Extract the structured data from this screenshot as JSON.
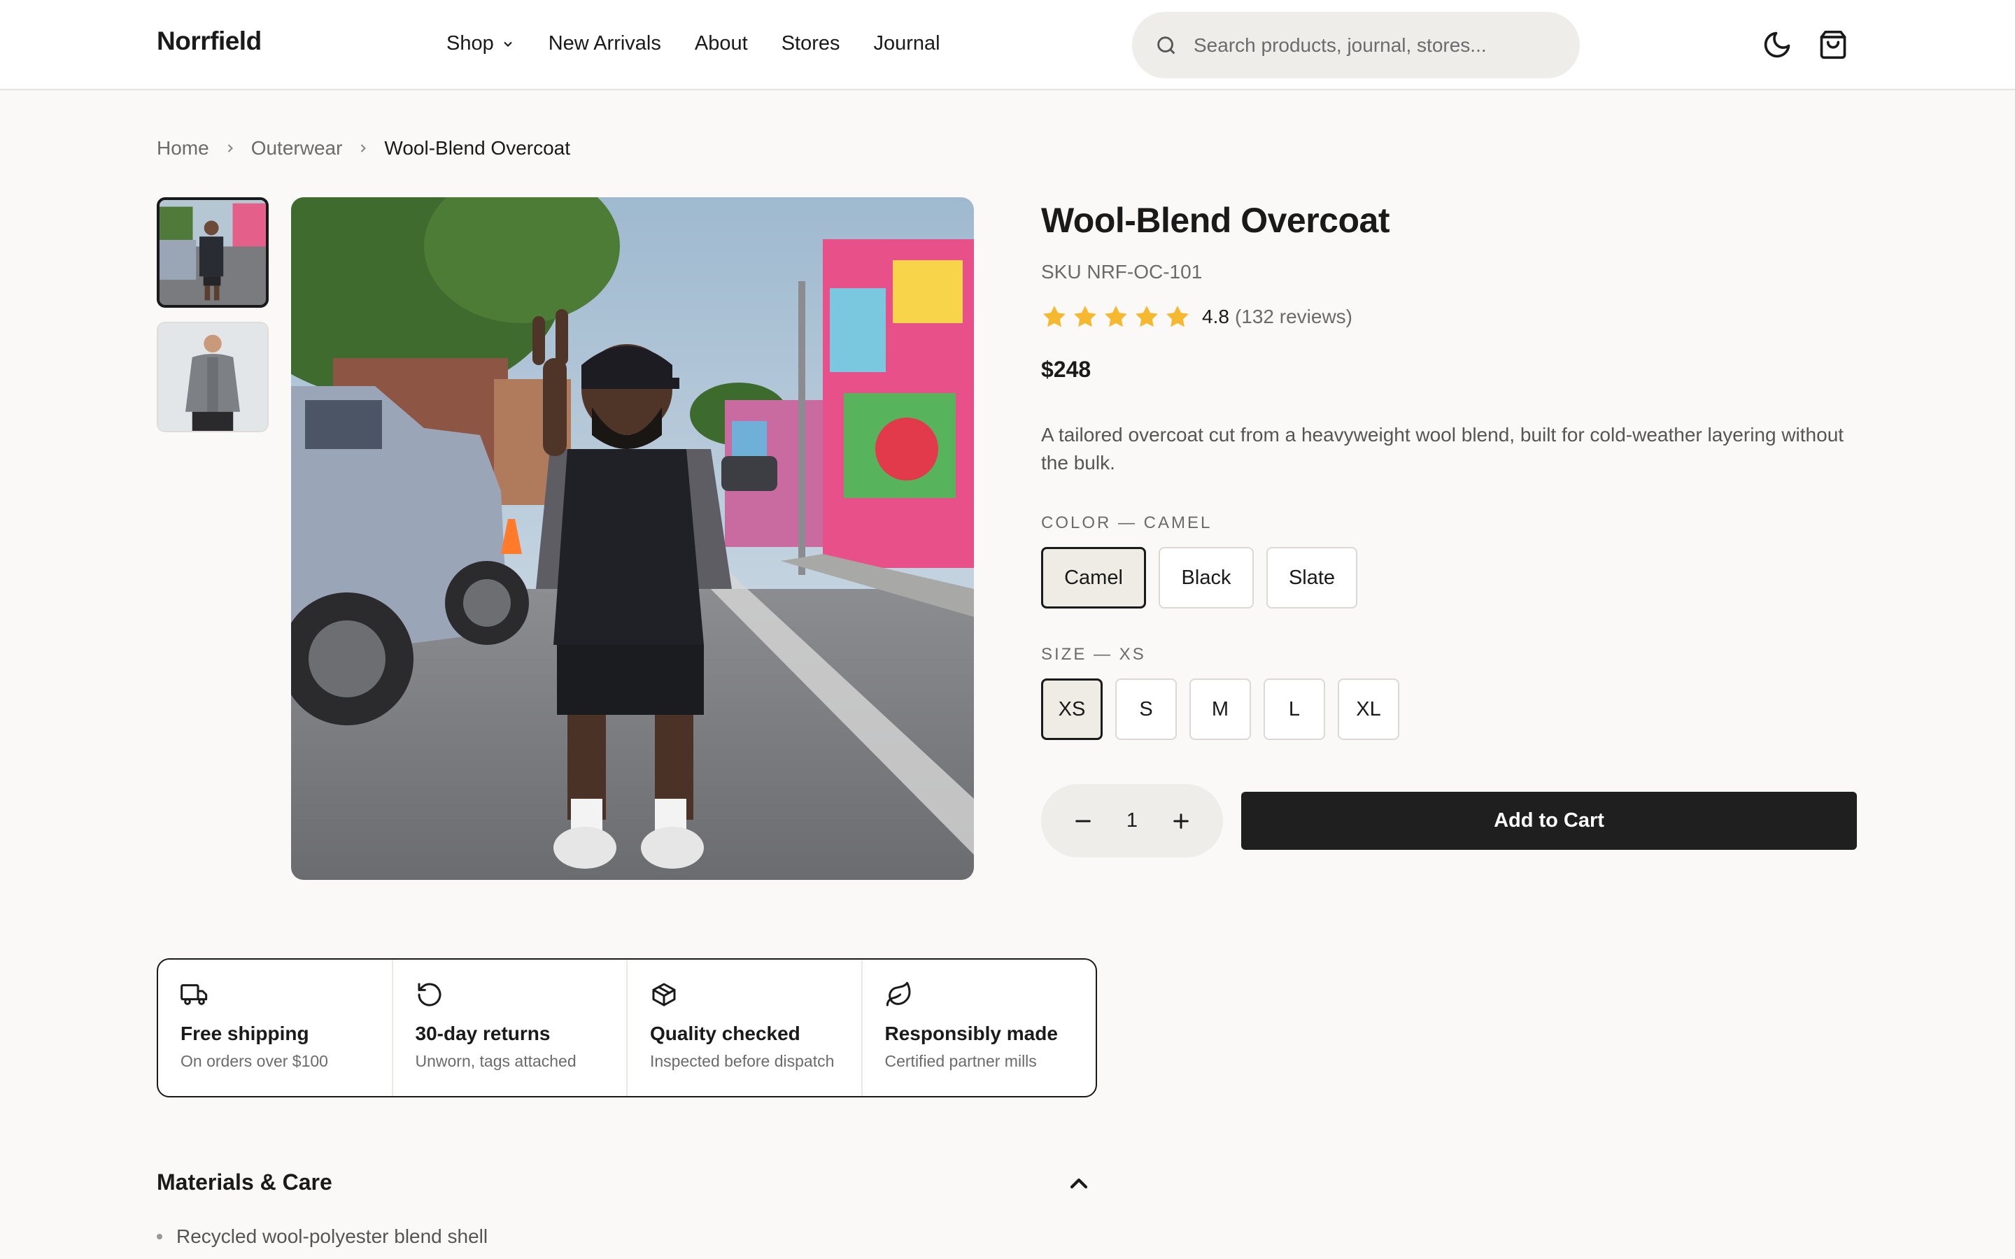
{
  "header": {
    "logo": "Norrfield",
    "nav": [
      {
        "label": "Shop",
        "has_dropdown": true
      },
      {
        "label": "New Arrivals"
      },
      {
        "label": "About"
      },
      {
        "label": "Stores"
      },
      {
        "label": "Journal"
      }
    ],
    "search_placeholder": "Search products, journal, stores...",
    "icons": [
      "moon-icon",
      "shopping-bag-icon"
    ]
  },
  "breadcrumb": [
    "Home",
    "Outerwear",
    "Wool-Blend Overcoat"
  ],
  "gallery": {
    "thumbnails": [
      "thumbnail-street-photo",
      "thumbnail-jacket-photo"
    ],
    "active_index": 0
  },
  "product": {
    "title": "Wool-Blend Overcoat",
    "sku": "SKU NRF-OC-101",
    "rating": {
      "value": "4.8",
      "count": "(132 reviews)",
      "stars": 5
    },
    "price": "$248",
    "description": "A tailored overcoat cut from a heavyweight wool blend, built for cold-weather layering without the bulk."
  },
  "options": {
    "color": {
      "label": "COLOR — CAMEL",
      "values": [
        "Camel",
        "Black",
        "Slate"
      ],
      "selected": "Camel"
    },
    "size": {
      "label": "SIZE — XS",
      "values": [
        "XS",
        "S",
        "M",
        "L",
        "XL"
      ],
      "selected": "XS"
    }
  },
  "quantity": "1",
  "add_to_cart": "Add to Cart",
  "features": [
    {
      "icon": "truck-icon",
      "title": "Free shipping",
      "sub": "On orders over $100"
    },
    {
      "icon": "rotate-ccw-icon",
      "title": "30-day returns",
      "sub": "Unworn, tags attached"
    },
    {
      "icon": "package-icon",
      "title": "Quality checked",
      "sub": "Inspected before dispatch"
    },
    {
      "icon": "leaf-icon",
      "title": "Responsibly made",
      "sub": "Certified partner mills"
    }
  ],
  "materials": {
    "title": "Materials & Care",
    "items": [
      "Recycled wool-polyester blend shell"
    ]
  },
  "colors": {
    "accent": "#1f1f1f",
    "star": "#f5b82e",
    "background": "#faf9f7"
  }
}
